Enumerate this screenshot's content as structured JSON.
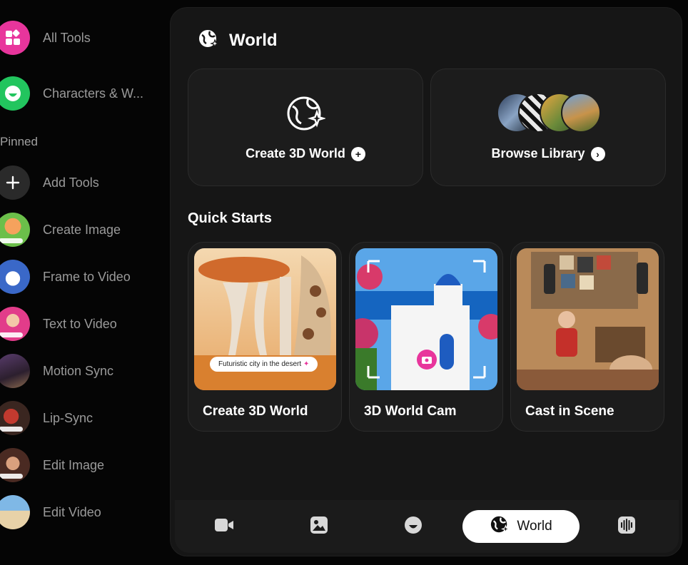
{
  "sidebar": {
    "top_items": [
      {
        "label": "All Tools",
        "icon": "grid-icon"
      },
      {
        "label": "Characters & W...",
        "icon": "smiley-icon"
      }
    ],
    "pinned_label": "Pinned",
    "pinned_items": [
      {
        "label": "Add Tools",
        "icon": "plus-icon"
      },
      {
        "label": "Create Image",
        "icon": "create-image-thumbnail"
      },
      {
        "label": "Frame to Video",
        "icon": "frame-to-video-thumbnail"
      },
      {
        "label": "Text to Video",
        "icon": "text-to-video-thumbnail"
      },
      {
        "label": "Motion Sync",
        "icon": "motion-sync-thumbnail"
      },
      {
        "label": "Lip-Sync",
        "icon": "lip-sync-thumbnail"
      },
      {
        "label": "Edit Image",
        "icon": "edit-image-thumbnail"
      },
      {
        "label": "Edit Video",
        "icon": "edit-video-thumbnail"
      }
    ]
  },
  "panel": {
    "title": "World",
    "title_icon": "globe-sparkle-icon",
    "cards": [
      {
        "label": "Create 3D World",
        "action_icon": "plus-circle-icon"
      },
      {
        "label": "Browse Library",
        "action_icon": "chevron-right-circle-icon"
      }
    ],
    "quick_starts_title": "Quick Starts",
    "quick_starts": [
      {
        "label": "Create 3D World",
        "overlay_text": "Futuristic city in the desert"
      },
      {
        "label": "3D World Cam"
      },
      {
        "label": "Cast in Scene"
      }
    ]
  },
  "bottom_nav": {
    "items": [
      {
        "icon": "video-camera-icon"
      },
      {
        "icon": "image-icon"
      },
      {
        "icon": "smiley-icon"
      },
      {
        "icon": "globe-sparkle-icon",
        "label": "World",
        "active": true
      },
      {
        "icon": "audio-waveform-icon"
      }
    ]
  },
  "colors": {
    "background": "#050505",
    "panel": "#161616",
    "card": "#1c1c1c",
    "accent_pink": "#e8359c",
    "accent_green": "#22c55e"
  }
}
